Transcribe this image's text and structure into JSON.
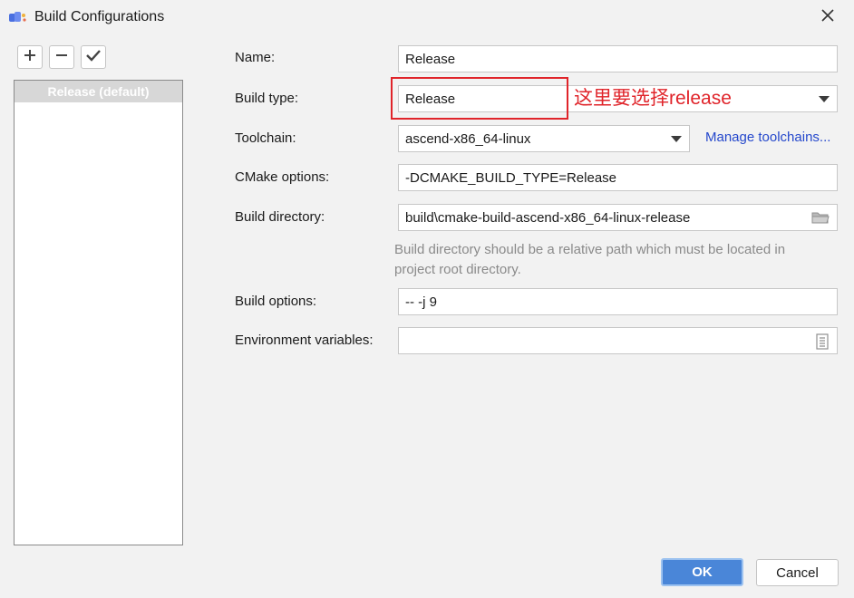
{
  "window": {
    "title": "Build Configurations",
    "app_icon": "cmake-icon",
    "close_icon": "close-icon"
  },
  "toolbar": {
    "add_icon": "plus-icon",
    "remove_icon": "minus-icon",
    "check_icon": "check-icon"
  },
  "configurations": [
    {
      "label": "Release (default)",
      "selected": true
    }
  ],
  "form": {
    "name_label": "Name:",
    "name_value": "Release",
    "build_type_label": "Build type:",
    "build_type_value": "Release",
    "toolchain_label": "Toolchain:",
    "toolchain_value": "ascend-x86_64-linux",
    "manage_toolchains": "Manage toolchains...",
    "cmake_options_label": "CMake options:",
    "cmake_options_value": "-DCMAKE_BUILD_TYPE=Release",
    "build_dir_label": "Build directory:",
    "build_dir_value": "build\\cmake-build-ascend-x86_64-linux-release",
    "build_dir_hint": "Build directory should be a relative path which must be located in project root directory.",
    "build_options_label": "Build options:",
    "build_options_value": "-- -j 9",
    "env_vars_label": "Environment variables:",
    "env_vars_value": ""
  },
  "annotation": {
    "text": "这里要选择release",
    "color": "#e0242a"
  },
  "buttons": {
    "ok": "OK",
    "cancel": "Cancel"
  },
  "colors": {
    "accent": "#4a86d8",
    "link": "#2548cc",
    "background": "#f2f2f2"
  }
}
